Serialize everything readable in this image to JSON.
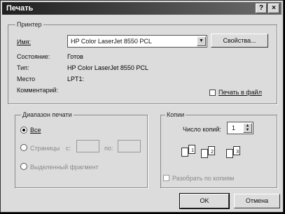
{
  "window": {
    "title": "Печать"
  },
  "titlebar": {
    "help_glyph": "?",
    "close_glyph": "×"
  },
  "printer": {
    "group_label": "Принтер",
    "name_label": "Имя:",
    "name_value": "HP Color LaserJet 8550 PCL",
    "properties_button": "Свойства...",
    "status_label": "Состояние:",
    "status_value": "Готов",
    "type_label": "Тип:",
    "type_value": "HP Color LaserJet 8550 PCL",
    "where_label": "Место",
    "where_value": "LPT1:",
    "comment_label": "Комментарий:",
    "print_to_file_label": "Печать в файл"
  },
  "range": {
    "group_label": "Диапазон печати",
    "all_label": "Все",
    "pages_label": "Страницы",
    "from_label": "с:",
    "to_label": "по:",
    "selection_label": "Выделенный фрагмент"
  },
  "copies": {
    "group_label": "Копии",
    "count_label": "Число копий:",
    "count_value": "1",
    "collate_label": "Разобрать по копиям",
    "page_numbers": [
      "1",
      "1",
      "2",
      "2",
      "3",
      "3"
    ]
  },
  "footer": {
    "ok_label": "OK",
    "cancel_label": "Отмена"
  }
}
